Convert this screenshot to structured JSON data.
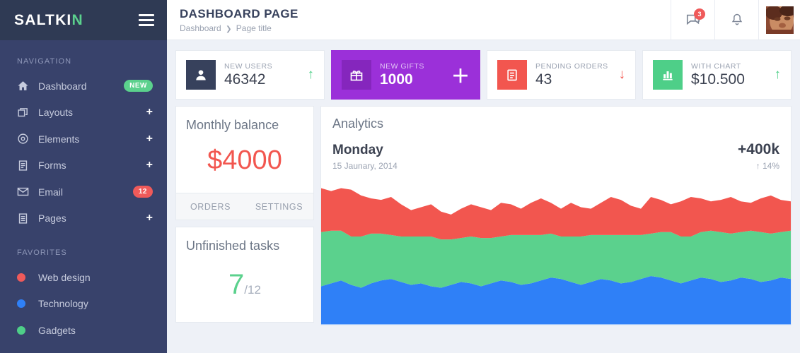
{
  "brand": {
    "text_main": "SALTKI",
    "text_accent": "N"
  },
  "sidebar": {
    "nav_heading": "NAVIGATION",
    "fav_heading": "FAVORITES",
    "items": [
      {
        "label": "Dashboard",
        "icon": "home-icon",
        "badge": "NEW",
        "badge_color": "#5bd18d"
      },
      {
        "label": "Layouts",
        "icon": "layers-icon",
        "expand": "+"
      },
      {
        "label": "Elements",
        "icon": "compass-icon",
        "expand": "+"
      },
      {
        "label": "Forms",
        "icon": "form-icon",
        "expand": "+"
      },
      {
        "label": "Email",
        "icon": "envelope-icon",
        "badge": "12",
        "badge_color": "#ef5a5a"
      },
      {
        "label": "Pages",
        "icon": "pages-icon",
        "expand": "+"
      }
    ],
    "favorites": [
      {
        "label": "Web design",
        "color": "#ef5a5a"
      },
      {
        "label": "Technology",
        "color": "#2f80f7"
      },
      {
        "label": "Gadgets",
        "color": "#4ecf88"
      }
    ]
  },
  "header": {
    "title": "DASHBOARD PAGE",
    "breadcrumb_root": "Dashboard",
    "breadcrumb_sep": "❯",
    "breadcrumb_current": "Page title",
    "messages_badge": "3"
  },
  "stats": [
    {
      "caption": "NEW USERS",
      "value": "46342",
      "icon": "user-icon",
      "icon_bg": "#37415c",
      "trend": "↑",
      "trend_dir": "up"
    },
    {
      "caption": "NEW GIFTS",
      "value": "1000",
      "icon": "gift-icon",
      "icon_bg": "#8526bd",
      "trend": "＋",
      "trend_dir": "white",
      "card_bg": "#9b30d9"
    },
    {
      "caption": "PENDING ORDERS",
      "value": "43",
      "icon": "clipboard-icon",
      "icon_bg": "#f2564f",
      "trend": "↓",
      "trend_dir": "down"
    },
    {
      "caption": "WITH CHART",
      "value": "$10.500",
      "icon": "bar-chart-icon",
      "icon_bg": "#4ecf88",
      "trend": "↑",
      "trend_dir": "up"
    }
  ],
  "balance_card": {
    "title": "Monthly balance",
    "value": "$4000",
    "footer_left": "ORDERS",
    "footer_right": "SETTINGS"
  },
  "tasks_card": {
    "title": "Unfinished tasks",
    "value": "7",
    "denominator": "/12"
  },
  "analytics": {
    "title": "Analytics",
    "day": "Monday",
    "date": "15 Jaunary, 2014",
    "total": "+400k",
    "change": "↑ 14%"
  },
  "chart_data": {
    "type": "area",
    "title": "Analytics",
    "stacked": true,
    "grid": false,
    "legend": "none",
    "xlabel": "",
    "ylabel": "",
    "ylim": [
      0,
      100
    ],
    "x": [
      0,
      1,
      2,
      3,
      4,
      5,
      6,
      7,
      8,
      9,
      10,
      11,
      12,
      13,
      14,
      15,
      16,
      17,
      18,
      19,
      20,
      21,
      22,
      23,
      24,
      25,
      26,
      27,
      28,
      29,
      30,
      31,
      32,
      33,
      34,
      35,
      36,
      37,
      38,
      39,
      40,
      41,
      42,
      43,
      44,
      45,
      46,
      47
    ],
    "series": [
      {
        "name": "blue",
        "color": "#2f80f7",
        "values": [
          26,
          28,
          30,
          27,
          25,
          28,
          30,
          31,
          29,
          27,
          28,
          26,
          25,
          27,
          29,
          28,
          26,
          28,
          30,
          29,
          27,
          28,
          30,
          32,
          31,
          29,
          27,
          29,
          31,
          30,
          28,
          29,
          31,
          33,
          32,
          30,
          28,
          30,
          32,
          31,
          29,
          30,
          32,
          31,
          29,
          30,
          32,
          31
        ]
      },
      {
        "name": "green",
        "color": "#5bd18d",
        "values": [
          37,
          36,
          34,
          33,
          35,
          34,
          32,
          30,
          31,
          33,
          32,
          34,
          33,
          31,
          30,
          32,
          33,
          31,
          30,
          32,
          34,
          33,
          31,
          30,
          29,
          31,
          33,
          32,
          30,
          31,
          33,
          32,
          30,
          29,
          31,
          33,
          32,
          30,
          31,
          33,
          34,
          32,
          31,
          33,
          34,
          32,
          31,
          33
        ]
      },
      {
        "name": "red",
        "color": "#f2564f",
        "values": [
          30,
          27,
          29,
          32,
          28,
          24,
          23,
          26,
          22,
          18,
          20,
          22,
          19,
          17,
          20,
          22,
          21,
          19,
          23,
          21,
          18,
          22,
          25,
          21,
          19,
          23,
          20,
          18,
          22,
          26,
          24,
          20,
          18,
          25,
          22,
          19,
          24,
          27,
          23,
          20,
          22,
          25,
          21,
          19,
          23,
          26,
          22,
          20
        ]
      }
    ]
  }
}
